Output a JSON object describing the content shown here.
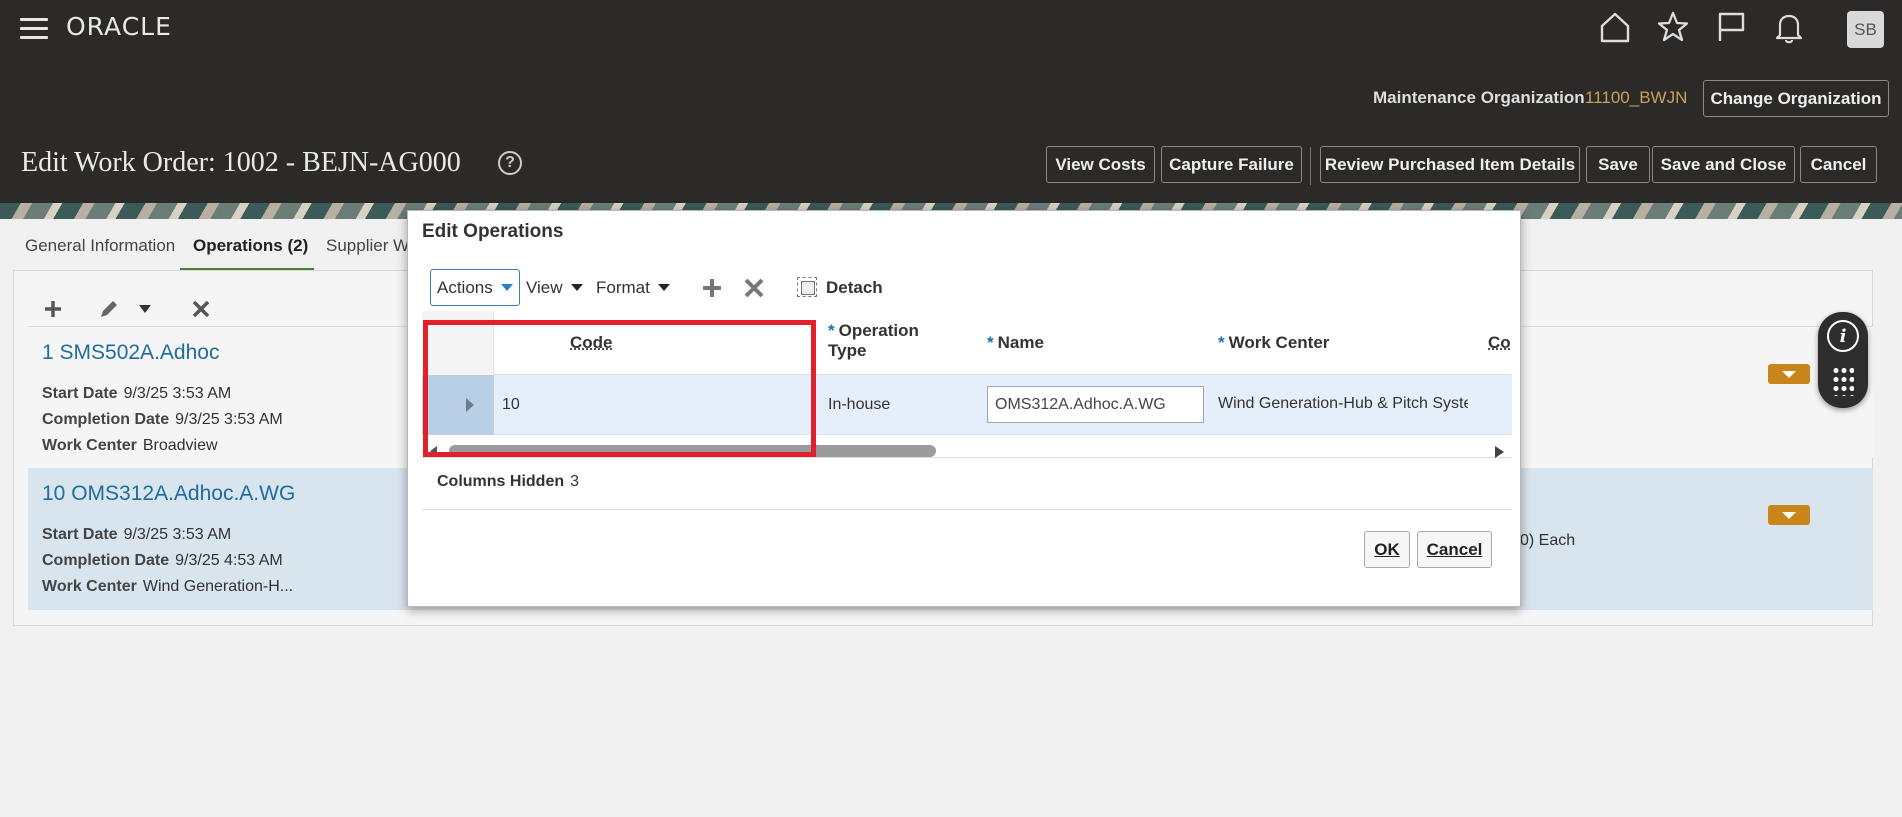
{
  "header": {
    "logo": "ORACLE",
    "avatar_initials": "SB",
    "maintenance_org_label": "Maintenance Organization",
    "maintenance_org_value": "11100_BWJN",
    "change_org_label": "Change Organization",
    "page_title": "Edit Work Order: 1002 - BEJN-AG000",
    "help_glyph": "?",
    "buttons": {
      "view_costs": "View Costs",
      "capture_failure": "Capture Failure",
      "review_purchased": "Review Purchased Item Details",
      "save": "Save",
      "save_close": "Save and Close",
      "cancel": "Cancel"
    },
    "icons": [
      "hamburger-icon",
      "home-icon",
      "star-icon",
      "flag-icon",
      "bell-icon"
    ]
  },
  "tabs": [
    {
      "label": "General Information"
    },
    {
      "label": "Operations (2)"
    },
    {
      "label": "Supplier W"
    }
  ],
  "operations": [
    {
      "title": "1 SMS502A.Adhoc",
      "start_label": "Start Date",
      "start_value": "9/3/25 3:53 AM",
      "completion_label": "Completion Date",
      "completion_value": "9/3/25 3:53 AM",
      "work_center_label": "Work Center",
      "work_center_value": "Broadview"
    },
    {
      "title": "10 OMS312A.Adhoc.A.WG",
      "start_label": "Start Date",
      "start_value": "9/3/25 3:53 AM",
      "completion_label": "Completion Date",
      "completion_value": "9/3/25 4:53 AM",
      "work_center_label": "Work Center",
      "work_center_value": "Wind Generation-H...",
      "side_text": "0)   Each"
    }
  ],
  "dialog": {
    "title": "Edit Operations",
    "toolbar": {
      "actions": "Actions",
      "view": "View",
      "format": "Format",
      "detach": "Detach"
    },
    "columns": {
      "code": "Code",
      "operation_type": "Operation Type",
      "name": "Name",
      "work_center": "Work Center",
      "truncated": "Co"
    },
    "required_marker": "*",
    "row": {
      "code": "10",
      "operation_type": "In-house",
      "name": "OMS312A.Adhoc.A.WG",
      "work_center": "Wind Generation-Hub & Pitch Syste"
    },
    "columns_hidden_label": "Columns Hidden",
    "columns_hidden_value": "3",
    "ok": "OK",
    "cancel": "Cancel"
  },
  "colors": {
    "header_bg": "#2b2a28",
    "link": "#1f6d9a",
    "accent_orange": "#c8861a",
    "highlight": "#e0202a",
    "selected_row": "#e4effb"
  }
}
